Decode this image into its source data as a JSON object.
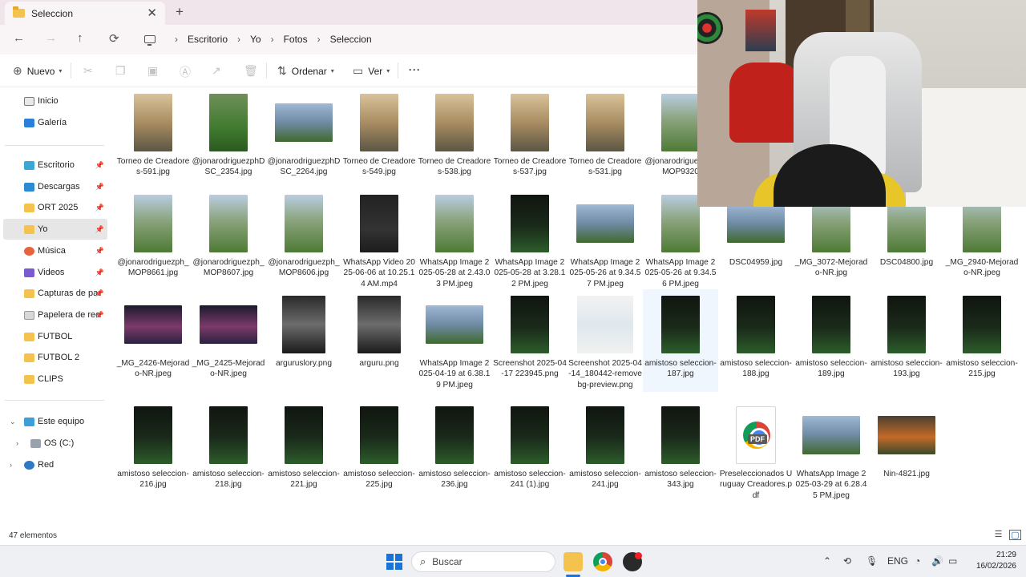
{
  "tab": {
    "title": "Seleccion",
    "close": "✕",
    "new": "+"
  },
  "nav": {
    "back": "←",
    "forward": "→",
    "up": "↑",
    "refresh": "⟳",
    "breadcrumbs": [
      "Escritorio",
      "Yo",
      "Fotos",
      "Seleccion"
    ]
  },
  "toolbar": {
    "new_label": "Nuevo",
    "sort_label": "Ordenar",
    "view_label": "Ver",
    "more": "···"
  },
  "sidebar": {
    "items": [
      {
        "label": "Inicio",
        "icon": "home-icon"
      },
      {
        "label": "Galería",
        "icon": "gallery-icon"
      },
      {
        "label": "Escritorio",
        "icon": "desktop-icon"
      },
      {
        "label": "Descargas",
        "icon": "downloads-icon"
      },
      {
        "label": "ORT 2025",
        "icon": "folder-icon"
      },
      {
        "label": "Yo",
        "icon": "folder-icon"
      },
      {
        "label": "Música",
        "icon": "music-icon"
      },
      {
        "label": "Videos",
        "icon": "videos-icon"
      },
      {
        "label": "Capturas de pant",
        "icon": "folder-icon"
      },
      {
        "label": "Papelera de recic",
        "icon": "recycle-bin-icon"
      },
      {
        "label": "FUTBOL",
        "icon": "folder-icon"
      },
      {
        "label": "FUTBOL 2",
        "icon": "folder-icon"
      },
      {
        "label": "CLIPS",
        "icon": "folder-icon"
      },
      {
        "label": "Este equipo",
        "icon": "computer-icon"
      },
      {
        "label": "OS (C:)",
        "icon": "drive-icon"
      },
      {
        "label": "Red",
        "icon": "network-icon"
      }
    ]
  },
  "files": [
    {
      "name": "Torneo de Creadores-591.jpg",
      "thumb": "sun"
    },
    {
      "name": "@jonarodriguezphDSC_2354.jpg",
      "thumb": "green"
    },
    {
      "name": "@jonarodriguezphDSC_2264.jpg",
      "thumb": "team"
    },
    {
      "name": "Torneo de Creadores-549.jpg",
      "thumb": "sun"
    },
    {
      "name": "Torneo de Creadores-538.jpg",
      "thumb": "sun"
    },
    {
      "name": "Torneo de Creadores-537.jpg",
      "thumb": "sun"
    },
    {
      "name": "Torneo de Creadores-531.jpg",
      "thumb": "sun"
    },
    {
      "name": "@jonarodriguezph_MOP9320",
      "thumb": "day"
    },
    {
      "name": "@jonarodriguezph_MOP8661.jpg",
      "thumb": "day"
    },
    {
      "name": "@jonarodriguezph_MOP8607.jpg",
      "thumb": "day"
    },
    {
      "name": "@jonarodriguezph_MOP8606.jpg",
      "thumb": "day"
    },
    {
      "name": "WhatsApp Video 2025-06-06 at 10.25.14 AM.mp4",
      "thumb": "dark"
    },
    {
      "name": "WhatsApp Image 2025-05-28 at 2.43.03 PM.jpeg",
      "thumb": "day"
    },
    {
      "name": "WhatsApp Image 2025-05-28 at 3.28.12 PM.jpeg",
      "thumb": "night"
    },
    {
      "name": "WhatsApp Image 2025-05-26 at 9.34.57 PM.jpeg",
      "thumb": "team"
    },
    {
      "name": "WhatsApp Image 2025-05-26 at 9.34.56 PM.jpeg",
      "thumb": "day"
    },
    {
      "name": "DSC04959.jpg",
      "thumb": "team"
    },
    {
      "name": "_MG_3072-Mejorado-NR.jpg",
      "thumb": "day"
    },
    {
      "name": "DSC04800.jpg",
      "thumb": "day"
    },
    {
      "name": "_MG_2940-Mejorado-NR.jpeg",
      "thumb": "day"
    },
    {
      "name": "_MG_2426-Mejorado-NR.jpeg",
      "thumb": "pink"
    },
    {
      "name": "_MG_2425-Mejorado-NR.jpeg",
      "thumb": "pink"
    },
    {
      "name": "arguruslory.png",
      "thumb": "poster"
    },
    {
      "name": "arguru.png",
      "thumb": "poster"
    },
    {
      "name": "WhatsApp Image 2025-04-19 at 6.38.19 PM.jpeg",
      "thumb": "team"
    },
    {
      "name": "Screenshot 2025-04-17 223945.png",
      "thumb": "night"
    },
    {
      "name": "Screenshot 2025-04-14_180442-removebg-preview.png",
      "thumb": "white"
    },
    {
      "name": "amistoso seleccion-187.jpg",
      "thumb": "night"
    },
    {
      "name": "amistoso seleccion-188.jpg",
      "thumb": "night"
    },
    {
      "name": "amistoso seleccion-189.jpg",
      "thumb": "night"
    },
    {
      "name": "amistoso seleccion-193.jpg",
      "thumb": "night"
    },
    {
      "name": "amistoso seleccion-215.jpg",
      "thumb": "night"
    },
    {
      "name": "amistoso seleccion-216.jpg",
      "thumb": "night"
    },
    {
      "name": "amistoso seleccion-218.jpg",
      "thumb": "night"
    },
    {
      "name": "amistoso seleccion-221.jpg",
      "thumb": "night"
    },
    {
      "name": "amistoso seleccion-225.jpg",
      "thumb": "night"
    },
    {
      "name": "amistoso seleccion-236.jpg",
      "thumb": "night"
    },
    {
      "name": "amistoso seleccion-241 (1).jpg",
      "thumb": "night"
    },
    {
      "name": "amistoso seleccion-241.jpg",
      "thumb": "night"
    },
    {
      "name": "amistoso seleccion-343.jpg",
      "thumb": "night"
    },
    {
      "name": "Preseleccionados Uruguay Creadores.pdf",
      "thumb": "pdf"
    },
    {
      "name": "WhatsApp Image 2025-03-29 at 6.28.45 PM.jpeg",
      "thumb": "team"
    },
    {
      "name": "Nin-4821.jpg",
      "thumb": "orange"
    }
  ],
  "status": {
    "count": "47 elementos"
  },
  "taskbar": {
    "search_placeholder": "Buscar",
    "lang": "ENG",
    "time": "21:29",
    "date": "16/02/2026"
  }
}
